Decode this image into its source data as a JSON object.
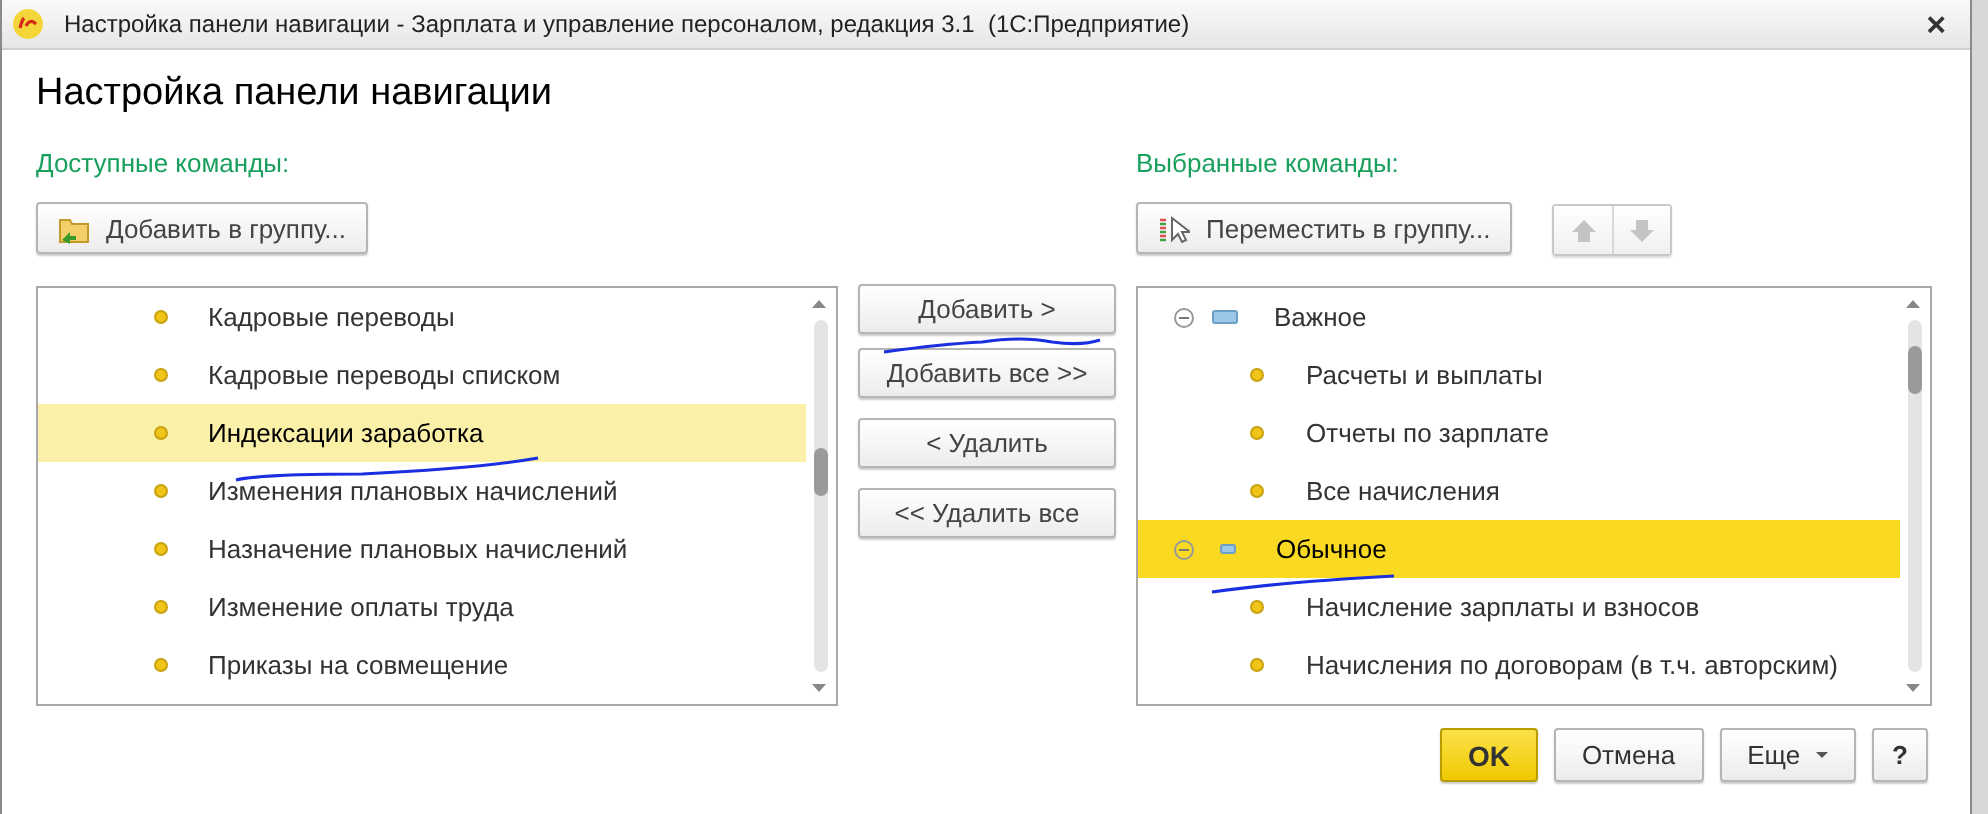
{
  "window": {
    "title": "Настройка панели навигации - Зарплата и управление персоналом, редакция 3.1  (1С:Предприятие)",
    "close": "×"
  },
  "heading": "Настройка панели навигации",
  "available": {
    "label": "Доступные команды:",
    "add_to_group": "Добавить в группу...",
    "items": [
      {
        "label": "Кадровые переводы",
        "selected": false
      },
      {
        "label": "Кадровые переводы списком",
        "selected": false
      },
      {
        "label": "Индексации заработка",
        "selected": true
      },
      {
        "label": "Изменения плановых начислений",
        "selected": false
      },
      {
        "label": "Назначение плановых начислений",
        "selected": false
      },
      {
        "label": "Изменение оплаты труда",
        "selected": false
      },
      {
        "label": "Приказы на совмещение",
        "selected": false
      }
    ]
  },
  "transfer_buttons": [
    "Добавить >",
    "Добавить все >>",
    "< Удалить",
    "<< Удалить все"
  ],
  "selected_commands": {
    "label": "Выбранные команды:",
    "move_to_group": "Переместить в группу...",
    "order_buttons": [
      {
        "kind": "up",
        "disabled": true
      },
      {
        "kind": "down",
        "disabled": true
      }
    ],
    "items": [
      {
        "label": "Важное",
        "kind": "group",
        "expanded": true,
        "selected": false,
        "children": [
          {
            "label": "Расчеты и выплаты",
            "selected": false
          },
          {
            "label": "Отчеты по зарплате",
            "selected": false
          },
          {
            "label": "Все начисления",
            "selected": false
          }
        ]
      },
      {
        "label": "Обычное",
        "kind": "group",
        "expanded": true,
        "selected": true,
        "children": [
          {
            "label": "Начисление зарплаты и взносов",
            "selected": false
          },
          {
            "label": "Начисления по договорам (в т.ч. авторским)",
            "selected": false
          }
        ]
      }
    ]
  },
  "footer": {
    "ok": "OK",
    "cancel": "Отмена",
    "more": "Еще",
    "help": "?"
  }
}
